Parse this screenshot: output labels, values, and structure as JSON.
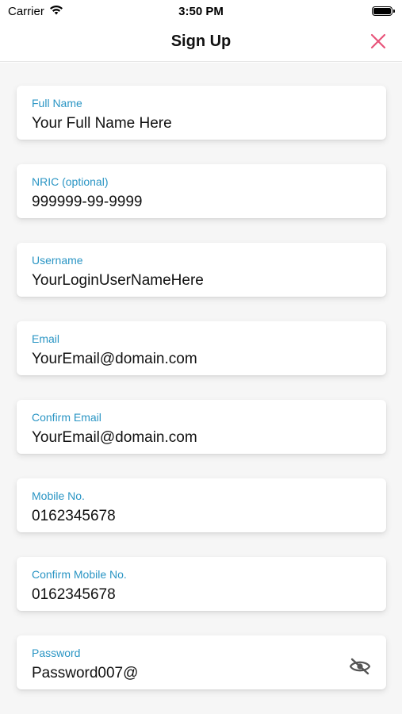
{
  "status_bar": {
    "carrier": "Carrier",
    "time": "3:50 PM"
  },
  "nav": {
    "title": "Sign Up",
    "close_icon": "close-icon",
    "close_color": "#e8547a"
  },
  "fields": [
    {
      "label": "Full Name",
      "value": "Your Full Name Here"
    },
    {
      "label": "NRIC (optional)",
      "value": "999999-99-9999"
    },
    {
      "label": "Username",
      "value": "YourLoginUserNameHere"
    },
    {
      "label": "Email",
      "value": "YourEmail@domain.com"
    },
    {
      "label": "Confirm Email",
      "value": "YourEmail@domain.com"
    },
    {
      "label": "Mobile No.",
      "value": "0162345678"
    },
    {
      "label": "Confirm Mobile No.",
      "value": "0162345678"
    },
    {
      "label": "Password",
      "value": "Password007@",
      "toggle_icon": "eye-off-icon"
    }
  ],
  "colors": {
    "label": "#2a95c4",
    "background": "#f6f6f6",
    "card": "#ffffff"
  }
}
